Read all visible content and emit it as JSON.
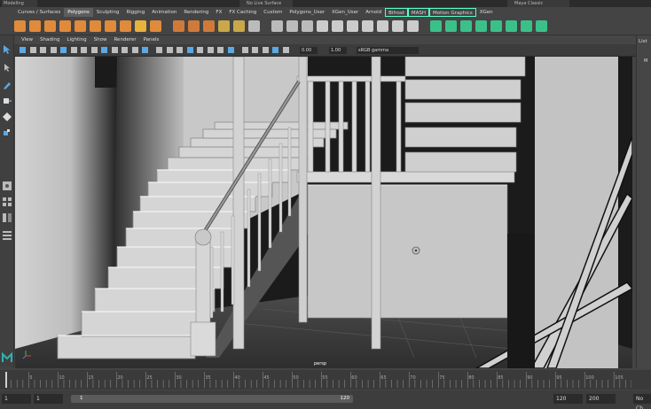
{
  "app": {
    "mode_label": "Modeling",
    "live_surface": "No Live Surface",
    "workspace": "Maya Classic"
  },
  "shelf_tabs": [
    {
      "label": "Curves / Surfaces",
      "active": false,
      "boxed": false
    },
    {
      "label": "Polygons",
      "active": true,
      "boxed": false
    },
    {
      "label": "Sculpting",
      "active": false,
      "boxed": false
    },
    {
      "label": "Rigging",
      "active": false,
      "boxed": false
    },
    {
      "label": "Animation",
      "active": false,
      "boxed": false
    },
    {
      "label": "Rendering",
      "active": false,
      "boxed": false
    },
    {
      "label": "FX",
      "active": false,
      "boxed": false
    },
    {
      "label": "FX Caching",
      "active": false,
      "boxed": false
    },
    {
      "label": "Custom",
      "active": false,
      "boxed": false
    },
    {
      "label": "Polygons_User",
      "active": false,
      "boxed": false
    },
    {
      "label": "XGen_User",
      "active": false,
      "boxed": false
    },
    {
      "label": "Arnold",
      "active": false,
      "boxed": false
    },
    {
      "label": "Bifrost",
      "active": false,
      "boxed": true
    },
    {
      "label": "MASH",
      "active": false,
      "boxed": true
    },
    {
      "label": "Motion Graphics",
      "active": false,
      "boxed": true
    },
    {
      "label": "XGen",
      "active": false,
      "boxed": false
    }
  ],
  "shelf_icons": [
    {
      "name": "poly-sphere-icon",
      "color": "#e08a3c"
    },
    {
      "name": "poly-cube-icon",
      "color": "#e08a3c"
    },
    {
      "name": "poly-cylinder-icon",
      "color": "#e08a3c"
    },
    {
      "name": "poly-cone-icon",
      "color": "#e08a3c"
    },
    {
      "name": "poly-torus-icon",
      "color": "#e08a3c"
    },
    {
      "name": "poly-plane-icon",
      "color": "#e08a3c"
    },
    {
      "name": "poly-disc-icon",
      "color": "#e08a3c"
    },
    {
      "name": "platonic-solid-icon",
      "color": "#e08a3c"
    },
    {
      "name": "poly-text-icon",
      "color": "#e8b23c"
    },
    {
      "name": "svg-icon",
      "color": "#e08a3c"
    },
    {
      "name": "combine-icon",
      "color": "#d07a3a"
    },
    {
      "name": "separate-icon",
      "color": "#d07a3a"
    },
    {
      "name": "smooth-icon",
      "color": "#d07a3a"
    },
    {
      "name": "bridge-icon",
      "color": "#c9a84a"
    },
    {
      "name": "extrude-icon",
      "color": "#c9a84a"
    },
    {
      "name": "bevel-icon",
      "color": "#bbbbbb"
    },
    {
      "name": "bool-union-icon",
      "color": "#bbbbbb"
    },
    {
      "name": "bool-diff-icon",
      "color": "#bbbbbb"
    },
    {
      "name": "bool-intersect-icon",
      "color": "#bbbbbb"
    },
    {
      "name": "multi-cut-icon",
      "color": "#cccccc"
    },
    {
      "name": "target-weld-icon",
      "color": "#cccccc"
    },
    {
      "name": "quad-draw-icon",
      "color": "#cccccc"
    },
    {
      "name": "mirror-icon",
      "color": "#cccccc"
    },
    {
      "name": "uv-editor-icon",
      "color": "#cccccc"
    },
    {
      "name": "planar-map-icon",
      "color": "#cccccc"
    },
    {
      "name": "auto-map-icon",
      "color": "#cccccc"
    },
    {
      "name": "bifrost-icon",
      "color": "#3cc08a"
    },
    {
      "name": "bifrost-liquid-icon",
      "color": "#3cc08a"
    },
    {
      "name": "mash-network-icon",
      "color": "#3cc08a"
    },
    {
      "name": "mash-distribute-icon",
      "color": "#3cc08a"
    },
    {
      "name": "mash-instancer-icon",
      "color": "#3cc08a"
    },
    {
      "name": "mash-repro-icon",
      "color": "#3cc08a"
    },
    {
      "name": "motion-graphics-icon",
      "color": "#3cc08a"
    },
    {
      "name": "xgen-icon",
      "color": "#3cc08a"
    }
  ],
  "panel_menu": [
    "View",
    "Shading",
    "Lighting",
    "Show",
    "Renderer",
    "Panels"
  ],
  "panel_toolbar": {
    "exposure": "0.00",
    "gamma": "1.00",
    "color_space": "sRGB gamma"
  },
  "viewport": {
    "camera": "persp"
  },
  "right_panel": {
    "label": "List",
    "sub_label": "M"
  },
  "time_slider": {
    "ticks": [
      1,
      5,
      10,
      15,
      20,
      25,
      30,
      35,
      40,
      45,
      50,
      55,
      60,
      65,
      70,
      75,
      80,
      85,
      90,
      95,
      100,
      105
    ],
    "labeled": [
      5,
      10,
      15,
      20,
      25,
      30,
      35,
      40,
      45,
      50,
      55,
      60,
      65,
      70,
      75,
      80,
      85,
      90,
      95,
      100,
      105
    ],
    "min": 1,
    "max": 108,
    "current": 1
  },
  "range": {
    "start": "1",
    "start_inner": "1",
    "track_start": "1",
    "track_end": "120",
    "end_inner": "120",
    "end": "200",
    "character_set": "No Ch"
  }
}
